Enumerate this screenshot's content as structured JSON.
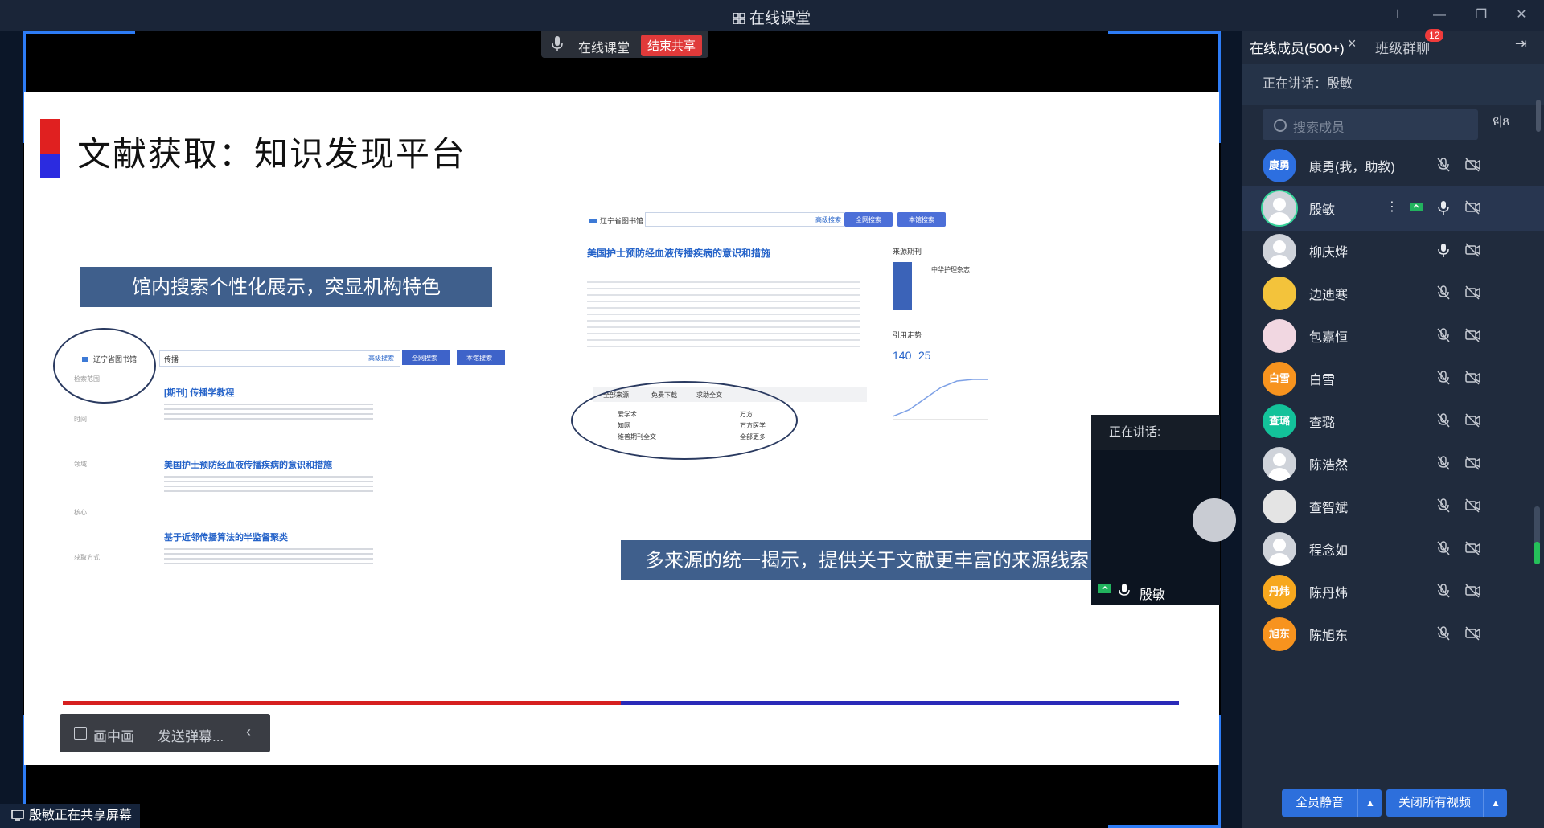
{
  "window": {
    "title": "在线课堂"
  },
  "share_bar": {
    "label": "在线课堂",
    "stop_label": "结束共享"
  },
  "slide": {
    "title": "文献获取：知识发现平台",
    "banner_left": "馆内搜索个性化展示，突显机构特色",
    "banner_right": "多来源的统一揭示，提供关于文献更丰富的来源线索",
    "left_shot": {
      "library": "辽宁省图书馆",
      "query": "传播",
      "buttons": [
        "高级搜索",
        "全网搜索",
        "本馆搜索"
      ],
      "sections": [
        "检索范围",
        "时间",
        "领域",
        "核心",
        "获取方式"
      ],
      "articles": [
        "[期刊] 传播学教程",
        "美国护士预防经血液传播疾病的意识和措施",
        "基于近邻传播算法的半监督聚类"
      ]
    },
    "right_shot": {
      "library": "辽宁省图书馆",
      "buttons": [
        "高级搜索",
        "全网搜索",
        "本馆搜索"
      ],
      "article_title": "美国护士预防经血液传播疾病的意识和措施",
      "source_journal": "来源期刊",
      "journal_name": "中华护理杂志",
      "cite_trend": "引用走势",
      "cite_numbers": [
        "140",
        "25"
      ],
      "source_tabs": [
        "全部来源",
        "免费下载",
        "求助全文"
      ],
      "sources": [
        "爱学术",
        "知网",
        "维普期刊全文",
        "万方",
        "万方医学",
        "全部更多"
      ]
    }
  },
  "controls": {
    "pip_label": "画中画",
    "danmu_label": "发送弹幕...",
    "collapse": "‹"
  },
  "sharing_status": "殷敏正在共享屏幕",
  "pip_window": {
    "header": "正在讲话:",
    "name": "殷敏"
  },
  "panel": {
    "tab_members": "在线成员(500+)",
    "tab_members_close": "×",
    "tab_group": "班级群聊",
    "group_badge": "12",
    "speaking": "正在讲话：殷敏",
    "search_placeholder": "搜索成员",
    "members": [
      {
        "name": "康勇(我，助教)",
        "avatar_text": "康勇",
        "avatar_color": "#2d6fe0"
      },
      {
        "name": "殷敏",
        "avatar_text": "",
        "avatar_color": "gray"
      },
      {
        "name": "柳庆烨",
        "avatar_text": "",
        "avatar_color": "gray"
      },
      {
        "name": "边迪寒",
        "avatar_text": "",
        "avatar_color": "#f3c33b"
      },
      {
        "name": "包嘉恒",
        "avatar_text": "",
        "avatar_color": "#f1d7e1"
      },
      {
        "name": "白雪",
        "avatar_text": "白雪",
        "avatar_color": "#f7931e"
      },
      {
        "name": "查璐",
        "avatar_text": "查璐",
        "avatar_color": "#13c29a"
      },
      {
        "name": "陈浩然",
        "avatar_text": "",
        "avatar_color": "gray"
      },
      {
        "name": "查智斌",
        "avatar_text": "",
        "avatar_color": "#e4e4e4"
      },
      {
        "name": "程念如",
        "avatar_text": "",
        "avatar_color": "gray"
      },
      {
        "name": "陈丹炜",
        "avatar_text": "丹炜",
        "avatar_color": "#f7a81e"
      },
      {
        "name": "陈旭东",
        "avatar_text": "旭东",
        "avatar_color": "#f7931e"
      }
    ],
    "mute_all": "全员静音",
    "close_all_video": "关闭所有视频"
  }
}
